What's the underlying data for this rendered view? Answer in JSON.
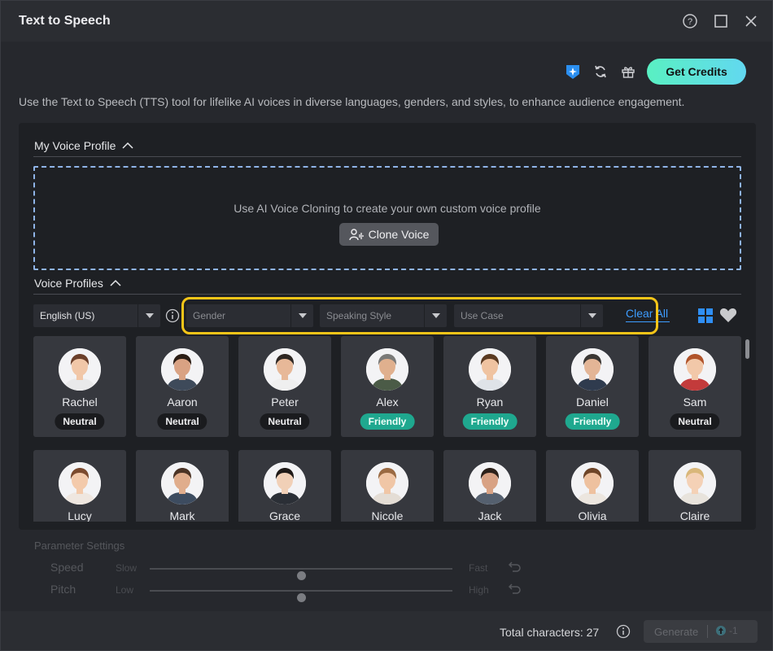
{
  "window": {
    "title": "Text to Speech"
  },
  "header": {
    "get_credits_label": "Get Credits"
  },
  "description": "Use the Text to Speech (TTS) tool for lifelike AI voices in diverse languages, genders, and styles, to enhance audience engagement.",
  "my_voice_profile": {
    "title": "My Voice Profile",
    "hint": "Use AI Voice Cloning to create your own custom voice profile",
    "clone_label": "Clone Voice"
  },
  "voice_profiles": {
    "title": "Voice Profiles",
    "filters": {
      "language": "English (US)",
      "gender_placeholder": "Gender",
      "style_placeholder": "Speaking Style",
      "usecase_placeholder": "Use Case",
      "clear_all": "Clear All"
    },
    "voices": [
      {
        "name": "Rachel",
        "style": "Neutral",
        "hair": "#6b3f2a",
        "skin": "#f1c7a8",
        "shirt": "#e9e9ea"
      },
      {
        "name": "Aaron",
        "style": "Neutral",
        "hair": "#2a1c14",
        "skin": "#d9a283",
        "shirt": "#3e4a5a"
      },
      {
        "name": "Peter",
        "style": "Neutral",
        "hair": "#2d2622",
        "skin": "#e7b898",
        "shirt": "#efefef"
      },
      {
        "name": "Alex",
        "style": "Friendly",
        "hair": "#7a7a78",
        "skin": "#e0b08e",
        "shirt": "#4b5b47"
      },
      {
        "name": "Ryan",
        "style": "Friendly",
        "hair": "#5a3a22",
        "skin": "#efc3a1",
        "shirt": "#dfe3e8"
      },
      {
        "name": "Daniel",
        "style": "Friendly",
        "hair": "#3a3633",
        "skin": "#e3b596",
        "shirt": "#2f3b4e"
      },
      {
        "name": "Sam",
        "style": "Neutral",
        "hair": "#b0532a",
        "skin": "#f2c8a9",
        "shirt": "#c33b3b"
      }
    ],
    "voices_row2": [
      {
        "name": "Lucy",
        "hair": "#7b4a2e",
        "skin": "#f3caab",
        "shirt": "#efe7e0"
      },
      {
        "name": "Mark",
        "hair": "#4a3325",
        "skin": "#e0ad8c",
        "shirt": "#3d4c60"
      },
      {
        "name": "Grace",
        "hair": "#1f1a18",
        "skin": "#f1d0b7",
        "shirt": "#2b2f36"
      },
      {
        "name": "Nicole",
        "hair": "#9a6a43",
        "skin": "#f0c6a6",
        "shirt": "#e4ddd5"
      },
      {
        "name": "Jack",
        "hair": "#2c211a",
        "skin": "#d8a284",
        "shirt": "#55606f"
      },
      {
        "name": "Olivia",
        "hair": "#6e4528",
        "skin": "#eec19f",
        "shirt": "#ece6df"
      },
      {
        "name": "Claire",
        "hair": "#d9b77a",
        "skin": "#f4d1b6",
        "shirt": "#e8e3dc"
      }
    ]
  },
  "parameters": {
    "title": "Parameter Settings",
    "speed": {
      "label": "Speed",
      "min_label": "Slow",
      "max_label": "Fast",
      "value": 0.5
    },
    "pitch": {
      "label": "Pitch",
      "min_label": "Low",
      "max_label": "High",
      "value": 0.5
    }
  },
  "footer": {
    "total_characters": "Total characters: 27",
    "generate_label": "Generate",
    "credit_cost": "-1"
  },
  "colors": {
    "accent": "#3d9cff",
    "highlight": "#f5c518",
    "friendly": "#1fa88f"
  }
}
